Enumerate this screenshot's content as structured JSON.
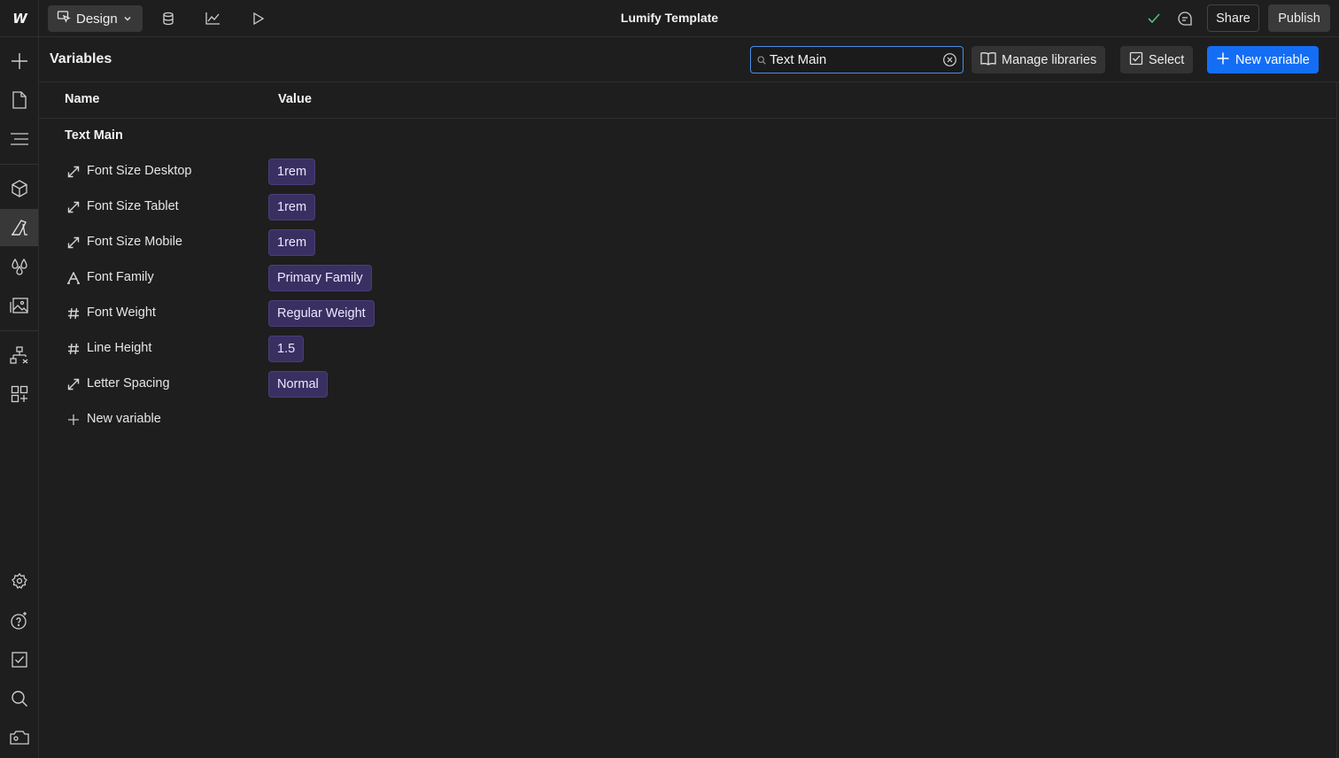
{
  "topbar": {
    "logo_text": "W",
    "mode_label": "Design",
    "app_title": "Lumify Template",
    "share_label": "Share",
    "publish_label": "Publish",
    "icons": [
      "cms-database-icon",
      "analytics-icon",
      "preview-play-icon",
      "saved-check-icon",
      "comments-icon"
    ]
  },
  "rail": {
    "icons": [
      "add-icon",
      "pages-icon",
      "navigator-icon",
      "components-icon",
      "variables-icon",
      "styles-icon",
      "assets-icon",
      "logic-icon",
      "apps-icon",
      "settings-icon",
      "help-ai-icon",
      "audit-checklist-icon",
      "search-icon",
      "video-tutorials-icon"
    ],
    "active": "variables-icon"
  },
  "panel": {
    "title": "Variables",
    "search_value": "Text Main",
    "manage_libraries_label": "Manage libraries",
    "select_label": "Select",
    "new_variable_label": "New variable"
  },
  "table": {
    "col_name": "Name",
    "col_value": "Value",
    "group_name": "Text Main",
    "rows": [
      {
        "icon": "size-icon",
        "name": "Font Size Desktop",
        "value": "1rem"
      },
      {
        "icon": "size-icon",
        "name": "Font Size Tablet",
        "value": "1rem"
      },
      {
        "icon": "size-icon",
        "name": "Font Size Mobile",
        "value": "1rem"
      },
      {
        "icon": "font-family-icon",
        "name": "Font Family",
        "value": "Primary Family"
      },
      {
        "icon": "number-icon",
        "name": "Font Weight",
        "value": "Regular Weight"
      },
      {
        "icon": "number-icon",
        "name": "Line Height",
        "value": "1.5"
      },
      {
        "icon": "size-icon",
        "name": "Letter Spacing",
        "value": "Normal"
      }
    ],
    "new_variable_row_label": "New variable"
  },
  "colors": {
    "background": "#1e1e1e",
    "chip": "#3a2f61",
    "accent_blue": "#146ef5",
    "saved_green": "#4cc37a"
  }
}
